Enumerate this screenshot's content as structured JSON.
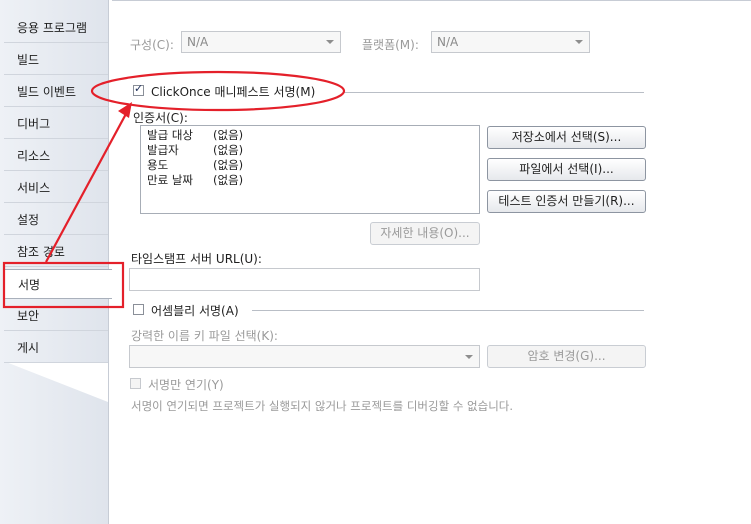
{
  "sidebar": {
    "items": [
      {
        "label": "응용 프로그램"
      },
      {
        "label": "빌드"
      },
      {
        "label": "빌드 이벤트"
      },
      {
        "label": "디버그"
      },
      {
        "label": "리소스"
      },
      {
        "label": "서비스"
      },
      {
        "label": "설정"
      },
      {
        "label": "참조 경로"
      },
      {
        "label": "서명"
      },
      {
        "label": "보안"
      },
      {
        "label": "게시"
      }
    ],
    "active": "서명"
  },
  "config": {
    "label": "구성(C):",
    "value": "N/A",
    "platform_label": "플랫폼(M):",
    "platform_value": "N/A"
  },
  "clickonce": {
    "checkbox_label": "ClickOnce 매니페스트 서명(M)",
    "checked": true,
    "cert_label": "인증서(C):",
    "cert_rows": [
      {
        "key": "발급 대상",
        "value": "(없음)"
      },
      {
        "key": "발급자",
        "value": "(없음)"
      },
      {
        "key": "용도",
        "value": "(없음)"
      },
      {
        "key": "만료 날짜",
        "value": "(없음)"
      }
    ],
    "btn_store": "저장소에서 선택(S)...",
    "btn_file": "파일에서 선택(I)...",
    "btn_test": "테스트 인증서 만들기(R)...",
    "btn_details": "자세한 내용(O)...",
    "timestamp_label": "타임스탬프 서버 URL(U):",
    "timestamp_value": ""
  },
  "assembly": {
    "checkbox_label": "어셈블리 서명(A)",
    "checked": false,
    "keyfile_label": "강력한 이름 키 파일 선택(K):",
    "keyfile_value": "",
    "btn_password": "암호 변경(G)...",
    "delay_label": "서명만 연기(Y)",
    "delay_note": "서명이 연기되면 프로젝트가 실행되지 않거나 프로젝트를 디버깅할 수 없습니다."
  },
  "annotation": {
    "color": "#e4202a"
  }
}
